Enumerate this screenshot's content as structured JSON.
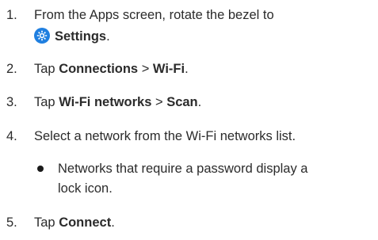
{
  "steps": [
    {
      "number": "1.",
      "line1": "From the Apps screen, rotate the bezel to",
      "line2_bold": "Settings",
      "line2_tail": ".",
      "icon": "settings-gear-icon",
      "icon_color": "#1f7fe0"
    },
    {
      "number": "2.",
      "prefix": "Tap ",
      "bold1": "Connections",
      "sep": " > ",
      "bold2": "Wi-Fi",
      "tail": "."
    },
    {
      "number": "3.",
      "prefix": "Tap ",
      "bold1": "Wi-Fi networks",
      "sep": " > ",
      "bold2": "Scan",
      "tail": "."
    },
    {
      "number": "4.",
      "text": "Select a network from the Wi-Fi networks list."
    },
    {
      "number": "5.",
      "prefix": "Tap ",
      "bold1": "Connect",
      "tail": "."
    }
  ],
  "bullet": {
    "line1": "Networks that require a password display a",
    "line2": "lock icon."
  }
}
